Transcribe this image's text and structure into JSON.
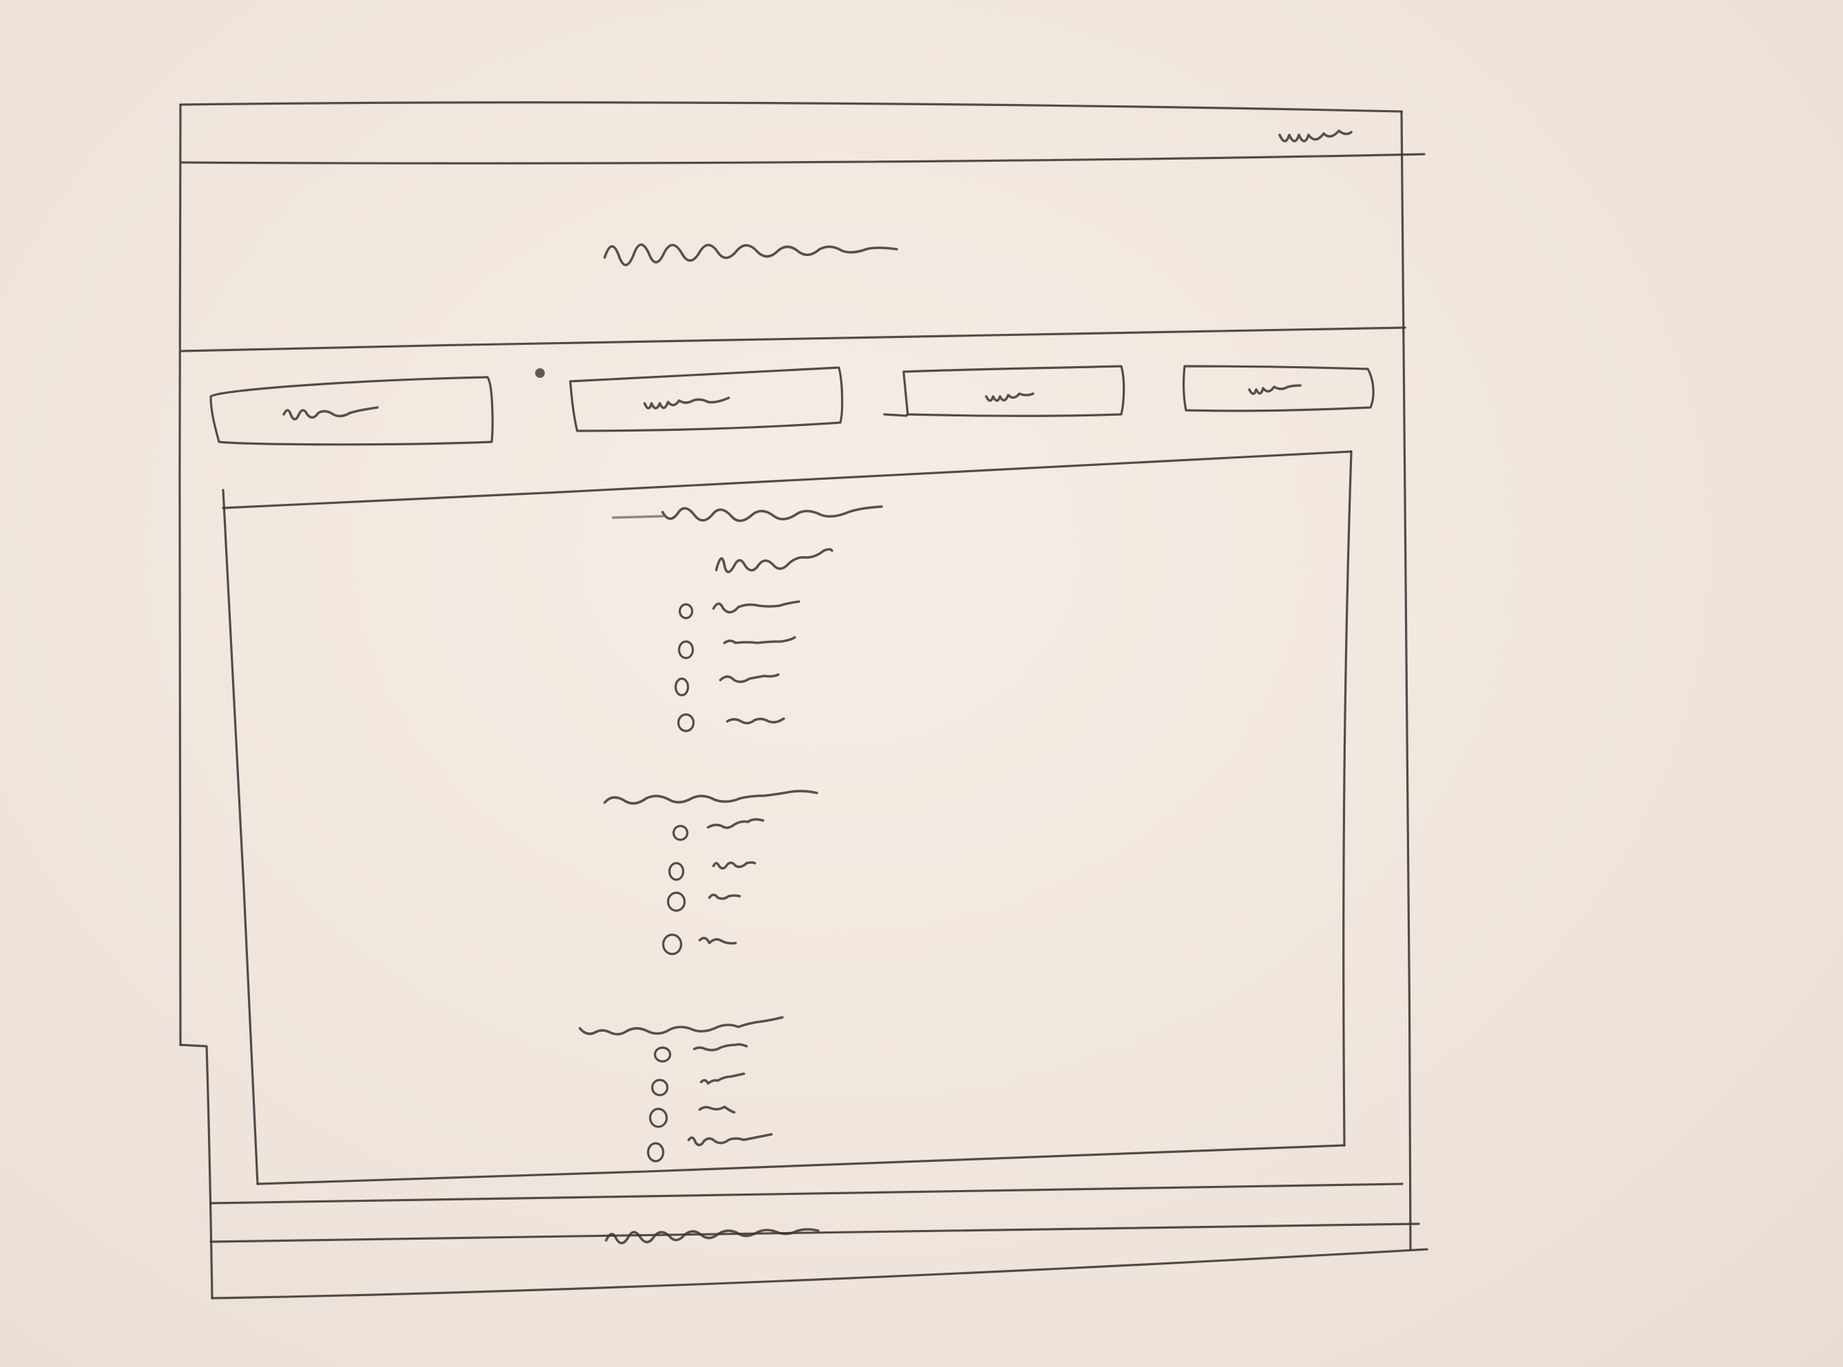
{
  "sketch": {
    "top_bar": {
      "right_label": "",
      "right_label_placeholder": "short-text"
    },
    "header": {
      "title": "",
      "title_placeholder": "long-text"
    },
    "tabs": [
      {
        "label": "",
        "placeholder": "short-text"
      },
      {
        "label": "",
        "placeholder": "short-text"
      },
      {
        "label": "",
        "placeholder": "short-text"
      },
      {
        "label": "",
        "placeholder": "short-text"
      }
    ],
    "content": {
      "page_heading": "",
      "groups": [
        {
          "heading": "",
          "sub_heading": "",
          "options": [
            "",
            "",
            "",
            ""
          ]
        },
        {
          "heading": "",
          "options": [
            "",
            "",
            "",
            ""
          ]
        },
        {
          "heading": "",
          "options": [
            "",
            "",
            "",
            ""
          ]
        }
      ]
    },
    "footer": {
      "text": "",
      "text_placeholder": "long-text"
    },
    "icons": {
      "radio": "radio-button-icon"
    }
  }
}
